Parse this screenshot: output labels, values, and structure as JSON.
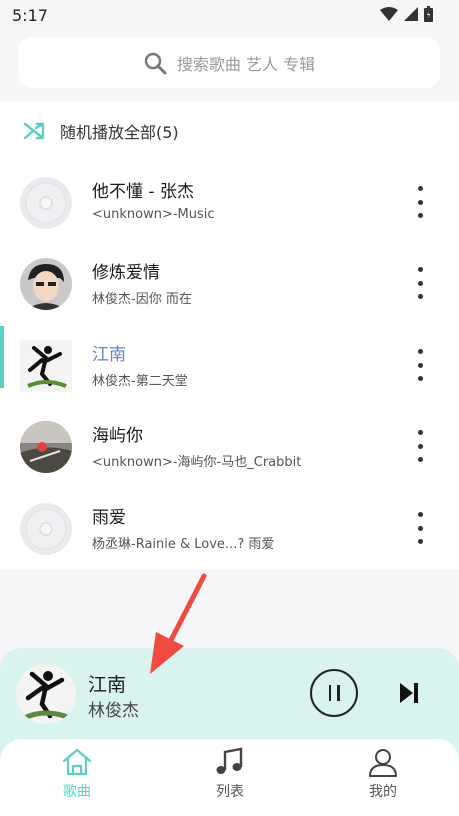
{
  "status": {
    "time": "5:17"
  },
  "search": {
    "placeholder": "搜索歌曲 艺人 专辑"
  },
  "shuffle": {
    "label": "随机播放全部(5)"
  },
  "songs": [
    {
      "title": "他不懂 - 张杰",
      "subtitle": "<unknown>-Music",
      "cover": "disc-placeholder"
    },
    {
      "title": "修炼爱情",
      "subtitle": "林俊杰-因你 而在",
      "cover": "cartoon-portrait"
    },
    {
      "title": "江南",
      "subtitle": "林俊杰-第二天堂",
      "cover": "album-art",
      "playing": true
    },
    {
      "title": "海屿你",
      "subtitle": "<unknown>-海屿你-马也_Crabbit",
      "cover": "album-art"
    },
    {
      "title": "雨爱",
      "subtitle": "杨丞琳-Rainie & Love...? 雨爱",
      "cover": "disc-placeholder"
    }
  ],
  "player": {
    "title": "江南",
    "artist": "林俊杰"
  },
  "nav": {
    "tabs": [
      {
        "label": "歌曲",
        "active": true
      },
      {
        "label": "列表"
      },
      {
        "label": "我的"
      }
    ]
  },
  "colors": {
    "accent": "#5ad0c4",
    "playing_title": "#5f85c8",
    "player_bg": "#d9f3ef",
    "arrow": "#f04a43"
  }
}
